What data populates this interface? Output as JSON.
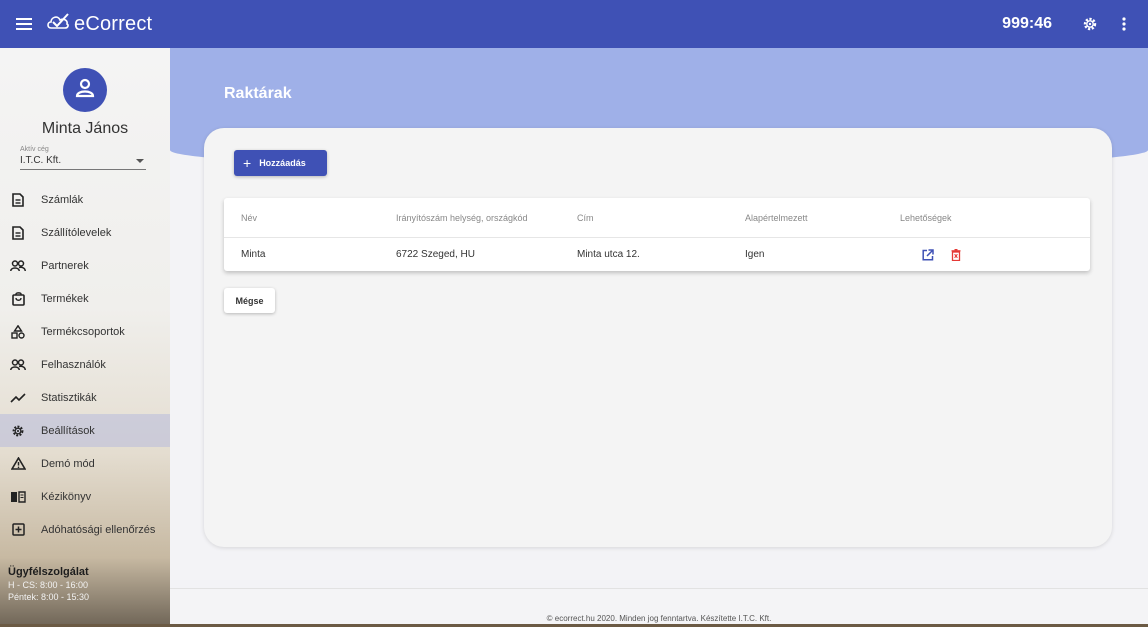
{
  "topbar": {
    "app_name": "eCorrect",
    "timer": "999:46",
    "icons": {
      "menu": "hamburger-menu-icon",
      "logo": "check-cloud-logo-icon",
      "settings": "gear-icon",
      "more": "more-vert-icon"
    },
    "color": "#3f51b5"
  },
  "sidebar": {
    "user_name": "Minta János",
    "company_label": "Aktív cég",
    "company_value": "I.T.C. Kft.",
    "items": [
      {
        "label": "Számlák",
        "icon": "document-icon",
        "active": false
      },
      {
        "label": "Szállítólevelek",
        "icon": "document-lines-icon",
        "active": false
      },
      {
        "label": "Partnerek",
        "icon": "people-icon",
        "active": false
      },
      {
        "label": "Termékek",
        "icon": "shopping-bag-icon",
        "active": false
      },
      {
        "label": "Termékcsoportok",
        "icon": "shapes-icon",
        "active": false
      },
      {
        "label": "Felhasználók",
        "icon": "people-icon",
        "active": false
      },
      {
        "label": "Statisztikák",
        "icon": "trend-line-icon",
        "active": false
      },
      {
        "label": "Beállítások",
        "icon": "gear-icon",
        "active": true
      },
      {
        "label": "Demó mód",
        "icon": "warning-icon",
        "active": false
      },
      {
        "label": "Kézikönyv",
        "icon": "book-icon",
        "active": false
      },
      {
        "label": "Adóhatósági ellenőrzés",
        "icon": "add-box-icon",
        "active": false
      }
    ],
    "support": {
      "title": "Ügyfélszolgálat",
      "hours_weekdays": "H - CS: 8:00 - 16:00",
      "hours_friday": "Péntek: 8:00 - 15:30"
    }
  },
  "main": {
    "title": "Raktárak",
    "add_button_label": "Hozzáadás",
    "cancel_button_label": "Mégse",
    "table": {
      "headers": [
        "Név",
        "Irányítószám helység, országkód",
        "Cím",
        "Alapértelmezett",
        "Lehetőségek"
      ],
      "rows": [
        {
          "name": "Minta",
          "postal": "6722 Szeged, HU",
          "address": "Minta utca 12.",
          "default": "Igen",
          "actions": [
            "edit-icon",
            "delete-icon"
          ]
        }
      ]
    },
    "colors": {
      "hero": "#9fb0e8",
      "edit": "#3f51b5",
      "delete": "#e53935"
    }
  },
  "footer": {
    "text": "© ecorrect.hu 2020. Minden jog fenntartva. Készítette I.T.C. Kft."
  }
}
